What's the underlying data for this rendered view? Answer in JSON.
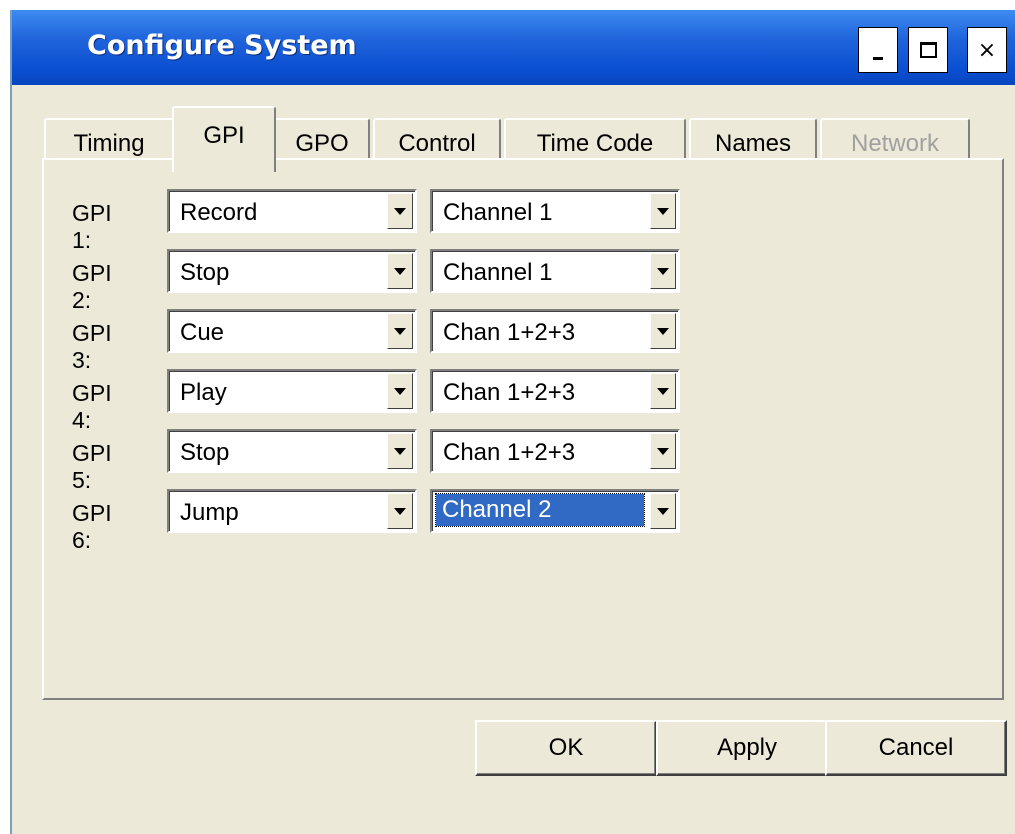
{
  "window": {
    "title": "Configure System",
    "controls": {
      "minimize": "_",
      "maximize": "□",
      "close": "×"
    }
  },
  "tabs": [
    {
      "label": "Timing",
      "active": false,
      "disabled": false
    },
    {
      "label": "GPI",
      "active": true,
      "disabled": false
    },
    {
      "label": "GPO",
      "active": false,
      "disabled": false
    },
    {
      "label": "Control",
      "active": false,
      "disabled": false
    },
    {
      "label": "Time Code",
      "active": false,
      "disabled": false
    },
    {
      "label": "Names",
      "active": false,
      "disabled": false
    },
    {
      "label": "Network",
      "active": false,
      "disabled": true
    }
  ],
  "gpi_rows": [
    {
      "label": "GPI 1:",
      "action": "Record",
      "channel": "Channel 1"
    },
    {
      "label": "GPI 2:",
      "action": "Stop",
      "channel": "Channel 1"
    },
    {
      "label": "GPI 3:",
      "action": "Cue",
      "channel": "Chan 1+2+3"
    },
    {
      "label": "GPI 4:",
      "action": "Play",
      "channel": "Chan 1+2+3"
    },
    {
      "label": "GPI 5:",
      "action": "Stop",
      "channel": "Chan 1+2+3"
    },
    {
      "label": "GPI 6:",
      "action": "Jump",
      "channel": "Channel 2"
    }
  ],
  "focused_field": "gpi_rows.5.channel",
  "buttons": {
    "ok": "OK",
    "apply": "Apply",
    "cancel": "Cancel"
  },
  "colors": {
    "title_bar": "#0a4fd1",
    "dialog_bg": "#ece9d8",
    "selection": "#316ac5"
  }
}
